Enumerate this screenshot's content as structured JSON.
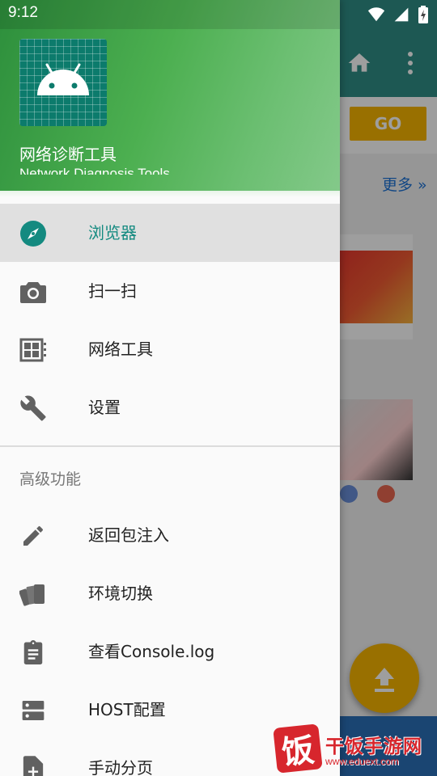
{
  "status_bar": {
    "time": "9:12"
  },
  "background": {
    "go_label": "GO",
    "more_label": "更多 »"
  },
  "drawer": {
    "header": {
      "app_name": "网络诊断工具",
      "app_subtitle": "Network Diagnosis Tools",
      "logo_icon": "android-icon"
    },
    "items": [
      {
        "label": "浏览器",
        "icon": "compass-icon",
        "active": true
      },
      {
        "label": "扫一扫",
        "icon": "camera-icon",
        "active": false
      },
      {
        "label": "网络工具",
        "icon": "grid-tool-icon",
        "active": false
      },
      {
        "label": "设置",
        "icon": "wrench-icon",
        "active": false
      }
    ],
    "section_title": "高级功能",
    "advanced_items": [
      {
        "label": "返回包注入",
        "icon": "pencil-icon"
      },
      {
        "label": "环境切换",
        "icon": "swatches-icon"
      },
      {
        "label": "查看Console.log",
        "icon": "clipboard-icon"
      },
      {
        "label": "HOST配置",
        "icon": "dns-icon"
      },
      {
        "label": "手动分页",
        "icon": "file-add-icon"
      }
    ]
  },
  "watermark": {
    "brand": "干饭手游网",
    "url": "www.eduext.com",
    "glyph": "饭"
  },
  "colors": {
    "accent": "#148a80",
    "header_green": "#4caf50",
    "icon_gray": "#616161",
    "active_bg": "#e0e0e0"
  }
}
